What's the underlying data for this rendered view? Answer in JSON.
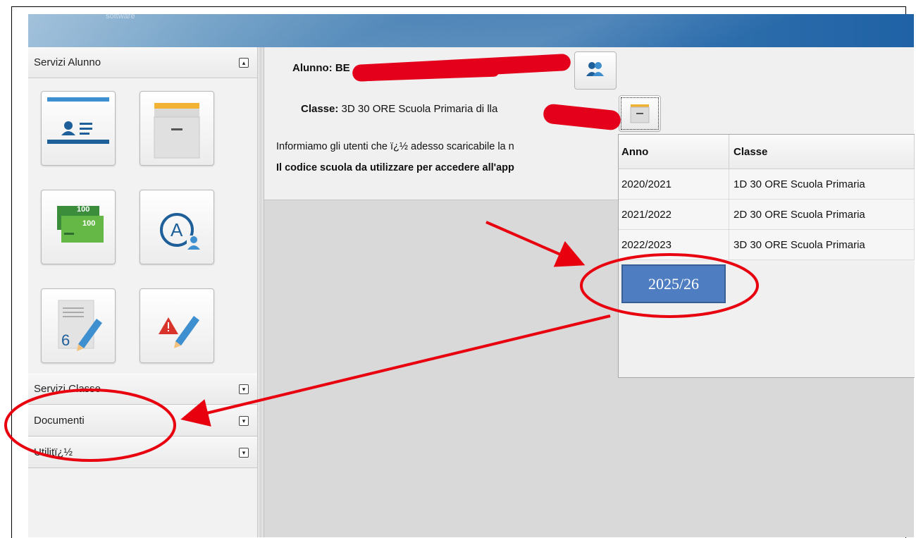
{
  "banner": {
    "brand_sub": "software"
  },
  "sidebar": {
    "sections": [
      {
        "title": "Servizi Alunno",
        "toggle": "▴"
      },
      {
        "title": "Servizi Classe",
        "toggle": "▾"
      },
      {
        "title": "Documenti",
        "toggle": "▾"
      },
      {
        "title": "Utilitï¿½",
        "toggle": "▾"
      }
    ],
    "tiles": [
      {
        "icon": "student-card-icon"
      },
      {
        "icon": "archive-drawer-icon"
      },
      {
        "icon": "banknotes-icon",
        "note_value": "100"
      },
      {
        "icon": "absence-a-icon",
        "letter": "A"
      },
      {
        "icon": "grades-pencil-icon",
        "digit": "6"
      },
      {
        "icon": "warning-pencil-icon"
      }
    ]
  },
  "student": {
    "label": "Alunno:",
    "name_visible": "BE  ...  AGO",
    "class_label": "Classe:",
    "class_value": "3D 30 ORE Scuola Primaria di",
    "class_tail": "lla"
  },
  "notice": {
    "line1": "Informiamo gli utenti che ï¿½ adesso scaricabile la n",
    "line2": "Il codice scuola da utilizzare per accedere all'app"
  },
  "class_history": {
    "headers": [
      "Anno",
      "Classe"
    ],
    "rows": [
      {
        "anno": "2020/2021",
        "classe": "1D 30 ORE Scuola Primaria"
      },
      {
        "anno": "2021/2022",
        "classe": "2D 30 ORE Scuola Primaria"
      },
      {
        "anno": "2022/2023",
        "classe": "3D 30 ORE Scuola Primaria"
      }
    ],
    "added_year": "2025/26"
  },
  "annotation": {
    "color": "#e8000f"
  }
}
